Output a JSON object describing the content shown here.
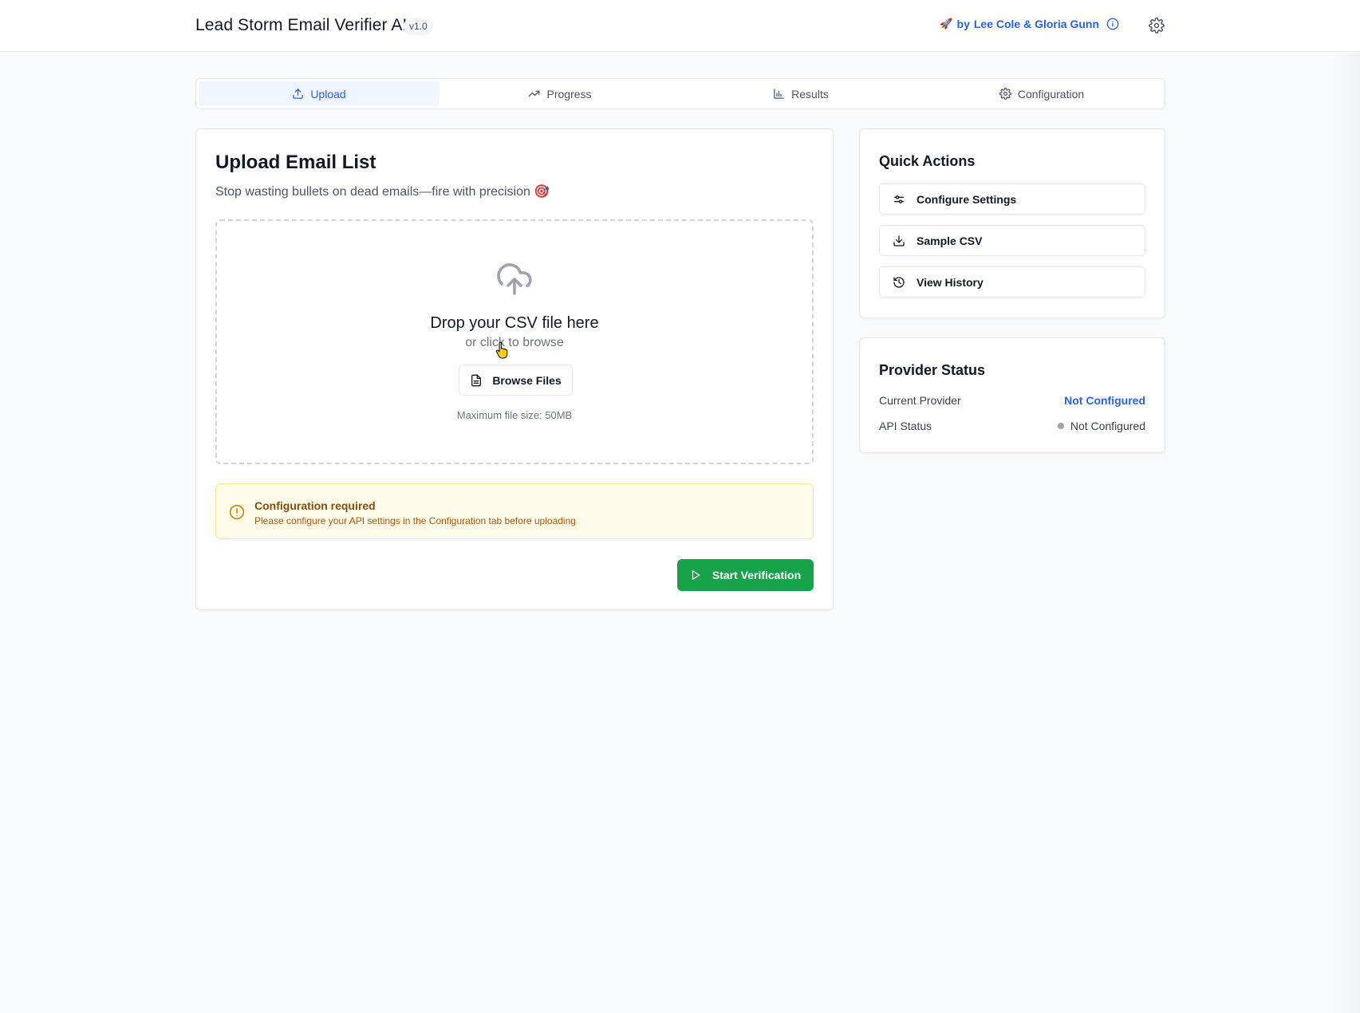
{
  "header": {
    "title": "Lead Storm Email Verifier AI",
    "version": "v1.0",
    "credit_icon": "rocket-icon",
    "credit_by": "by",
    "credit_names": "Lee Cole & Gloria Gunn"
  },
  "tabs": [
    {
      "label": "Upload",
      "icon": "upload-icon",
      "active": true
    },
    {
      "label": "Progress",
      "icon": "trending-up-icon",
      "active": false
    },
    {
      "label": "Results",
      "icon": "bar-chart-icon",
      "active": false
    },
    {
      "label": "Configuration",
      "icon": "gear-icon",
      "active": false
    }
  ],
  "upload": {
    "title": "Upload Email List",
    "subtitle": "Stop wasting bullets on dead emails—fire with precision 🎯",
    "drop_title": "Drop your CSV file here",
    "drop_sub": "or click to browse",
    "browse_label": "Browse Files",
    "max_size": "Maximum file size: 50MB"
  },
  "alert": {
    "title": "Configuration required",
    "text": "Please configure your API settings in the Configuration tab before uploading"
  },
  "start_label": "Start Verification",
  "quick_actions": {
    "title": "Quick Actions",
    "items": [
      {
        "label": "Configure Settings",
        "icon": "sliders-icon"
      },
      {
        "label": "Sample CSV",
        "icon": "download-icon"
      },
      {
        "label": "View History",
        "icon": "history-icon"
      }
    ]
  },
  "provider_status": {
    "title": "Provider Status",
    "rows": [
      {
        "label": "Current Provider",
        "value": "Not Configured"
      },
      {
        "label": "API Status",
        "value": "Not Configured"
      }
    ]
  },
  "colors": {
    "accent": "#2563eb",
    "success": "#16a34a",
    "warning_bg": "#fefce8",
    "warning_text": "#854d0e"
  }
}
